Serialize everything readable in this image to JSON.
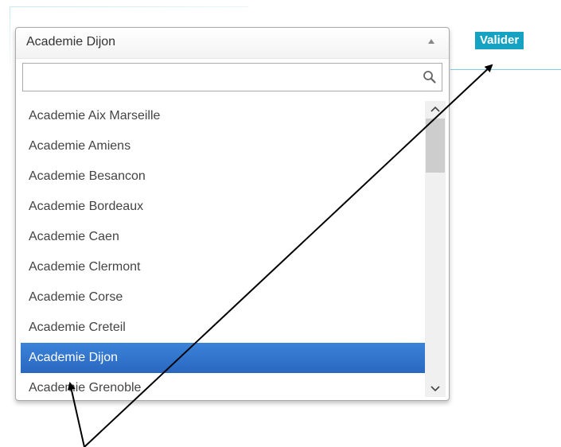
{
  "select": {
    "selected_value": "Academie Dijon",
    "search_value": "",
    "options": [
      "Academie Aix Marseille",
      "Academie Amiens",
      "Academie Besancon",
      "Academie Bordeaux",
      "Academie Caen",
      "Academie Clermont",
      "Academie Corse",
      "Academie Creteil",
      "Academie Dijon",
      "Academie Grenoble"
    ],
    "highlighted_index": 8
  },
  "valider_label": "Valider",
  "icons": {
    "search": "search-icon",
    "arrow": "chevron-up-icon",
    "scroll_up": "chevron-up-icon",
    "scroll_down": "chevron-down-icon"
  },
  "colors": {
    "accent": "#16a2c2",
    "highlight": "#2a67c0",
    "annotation": "#000000"
  }
}
